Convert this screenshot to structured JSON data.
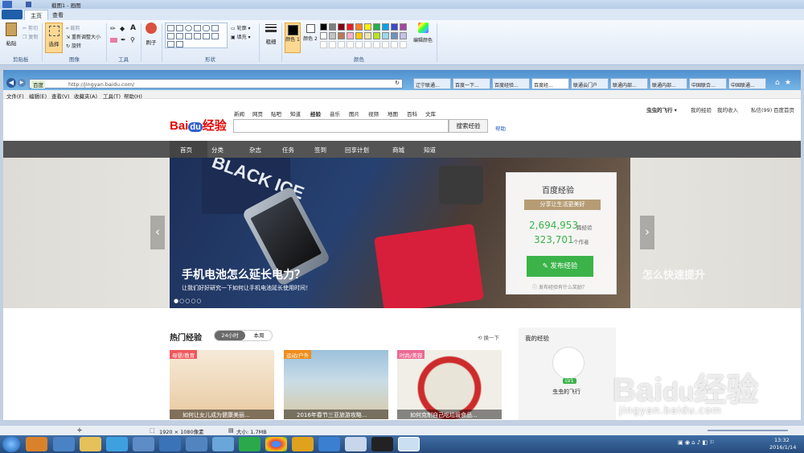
{
  "paint": {
    "title": "截图1 - 画图",
    "tabs": [
      "主页",
      "查看"
    ],
    "clipboard": {
      "paste": "粘贴",
      "cut": "剪切",
      "copy": "复制",
      "label": "剪贴板"
    },
    "image": {
      "select": "选择",
      "crop": "裁剪",
      "resize": "重新调整大小",
      "rotate": "旋转",
      "label": "图像"
    },
    "tools": {
      "label": "工具"
    },
    "brushes": "刷子",
    "shapes": {
      "outline": "轮廓",
      "fill": "填充",
      "label": "形状"
    },
    "size": "粗细",
    "colors": {
      "color1": "颜色 1",
      "color2": "颜色 2",
      "edit": "编辑颜色",
      "label": "颜色"
    },
    "palette": [
      "#000000",
      "#7f7f7f",
      "#880015",
      "#ed1c24",
      "#ff7f27",
      "#fff200",
      "#22b14c",
      "#00a2e8",
      "#3f48cc",
      "#a349a4",
      "#ffffff",
      "#c3c3c3",
      "#b97a57",
      "#ffaec9",
      "#ffc90e",
      "#efe4b0",
      "#b5e61d",
      "#99d9ea",
      "#7092be",
      "#c8bfe7"
    ],
    "status": {
      "dimensions": "1920 × 1080像素",
      "size": "大小: 1.7MB"
    }
  },
  "browser": {
    "address_prefix": "百度",
    "url": "http://jingyan.baidu.com/",
    "tabs": [
      "辽宁联通...",
      "百度一下...",
      "百度经验...",
      "百度经...",
      "联通云门户",
      "联通内部...",
      "联通内部...",
      "中国联合...",
      "中国联通..."
    ],
    "menu": [
      "文件(F)",
      "编辑(E)",
      "查看(V)",
      "收藏夹(A)",
      "工具(T)",
      "帮助(H)"
    ]
  },
  "site": {
    "user": "虫虫的飞行",
    "top_links": [
      "我的经验",
      "我的收入",
      "私信(99)",
      "百度首页"
    ],
    "search_tabs": [
      "新闻",
      "网页",
      "贴吧",
      "知道",
      "经验",
      "音乐",
      "图片",
      "视频",
      "地图",
      "百科",
      "文库"
    ],
    "search_button": "搜索经验",
    "help": "帮助",
    "nav": [
      "首页",
      "分类",
      "杂志",
      "任务",
      "签到",
      "回享计划",
      "商城",
      "知道"
    ],
    "hero": {
      "title": "手机电池怎么延长电力？",
      "subtitle": "让我们好好研究一下如何让手机电池延长使用时间！",
      "brand": "百度经验",
      "slogan": "分享让生活更美好",
      "count1": "2,694,953",
      "count1_label": "篇经验",
      "count2": "323,701",
      "count2_label": "个作者",
      "publish": "发布经验",
      "reward": "发布经验有什么奖励？",
      "ghost_text": "怎么快速提升"
    },
    "hot": {
      "title": "热门经验",
      "period_tabs": [
        "24小时",
        "本周"
      ],
      "refresh": "换一下",
      "cards": [
        {
          "tag": "母婴/教育",
          "tag_color": "#f0595c",
          "caption": "如何让女儿成为健康美丽..."
        },
        {
          "tag": "运动/户外",
          "tag_color": "#f08d1c",
          "caption": "2016年春节三亚旅游攻略..."
        },
        {
          "tag": "时尚/美容",
          "tag_color": "#ec6a94",
          "caption": "如何克制自己吃垃圾食品..."
        }
      ]
    },
    "my_exp": {
      "title": "我的经验",
      "level": "LV1",
      "user": "虫虫的飞行"
    }
  },
  "watermark": {
    "logo": "Bai du经验",
    "url": "jingyan.baidu.com"
  },
  "taskbar": {
    "time": "13:32",
    "date": "2016/1/14"
  }
}
